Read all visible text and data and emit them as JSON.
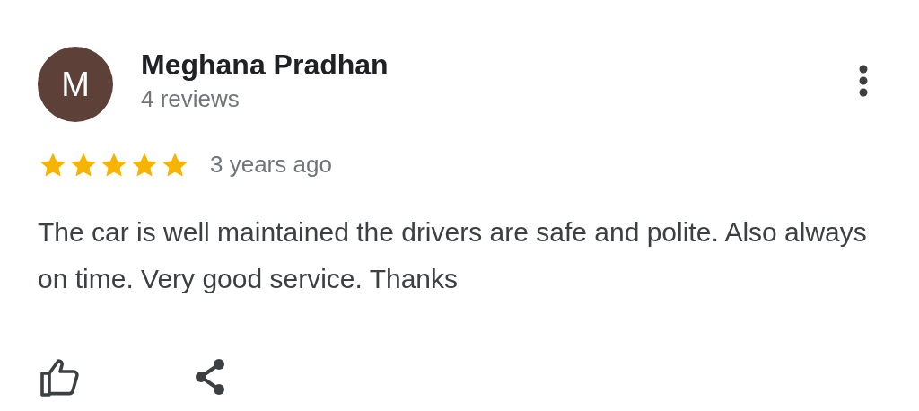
{
  "review": {
    "avatar": {
      "letter": "M",
      "color": "#5d4037"
    },
    "author": "Meghana Pradhan",
    "meta": "4 reviews",
    "stars": 5,
    "time": "3 years ago",
    "text": "The car is well maintained the drivers are safe and polite. Also always on time. Very good service. Thanks"
  }
}
